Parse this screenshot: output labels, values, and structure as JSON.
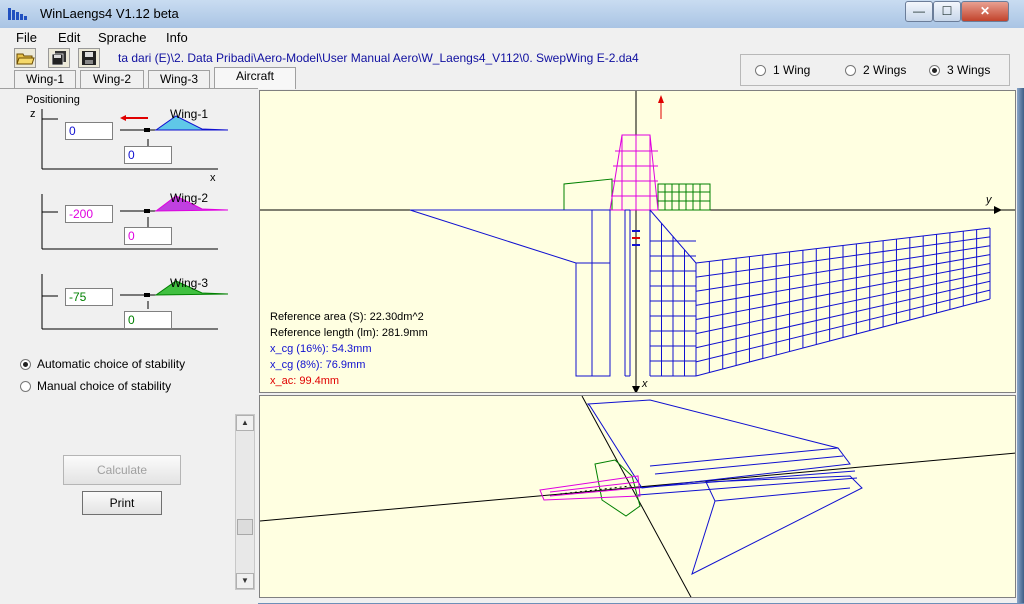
{
  "window": {
    "title": "WinLaengs4  V1.12  beta"
  },
  "title_buttons": {
    "minimize": "—",
    "maximize": "☐",
    "close": "✕"
  },
  "menu": [
    "File",
    "Edit",
    "Sprache",
    "Info"
  ],
  "toolbar": {
    "icons": [
      "open-folder-icon",
      "save-all-icon",
      "save-icon"
    ],
    "file_path": "ta dari (E)\\2. Data Pribadi\\Aero-Model\\User Manual Aero\\W_Laengs4_V112\\0. SwepWing E-2.da4"
  },
  "wing_count": {
    "options": [
      "1 Wing",
      "2 Wings",
      "3 Wings"
    ],
    "selected": "3 Wings"
  },
  "tabs": [
    "Wing-1",
    "Wing-2",
    "Wing-3",
    "Aircraft"
  ],
  "active_tab": "Aircraft",
  "positioning": {
    "title": "Positioning",
    "z_axis": "z",
    "x_axis": "x",
    "wings": [
      {
        "name": "Wing-1",
        "z": "0",
        "x": "0",
        "color": "#1010d0"
      },
      {
        "name": "Wing-2",
        "z": "-200",
        "x": "0",
        "color": "#e000e0"
      },
      {
        "name": "Wing-3",
        "z": "-75",
        "x": "0",
        "color": "#008000"
      }
    ]
  },
  "stability": {
    "options": [
      "Automatic choice of stability",
      "Manual choice of stability"
    ],
    "selected": "Automatic choice of stability"
  },
  "buttons": {
    "calculate": "Calculate",
    "print": "Print"
  },
  "top_view": {
    "axis_y": "y",
    "axis_x": "x",
    "reference_area": "Reference area (S): 22.30dm^2",
    "reference_length": "Reference length (lm): 281.9mm",
    "x_cg_16": "x_cg (16%): 54.3mm",
    "x_cg_8": "x_cg (8%): 76.9mm",
    "x_ac": "x_ac: 99.4mm"
  },
  "colors": {
    "wing1": "#1010d0",
    "wing2": "#e000e0",
    "wing3": "#008000",
    "highlight": "#e00000",
    "info_blue": "#1010d0",
    "plot_bg": "#ffffe1"
  }
}
